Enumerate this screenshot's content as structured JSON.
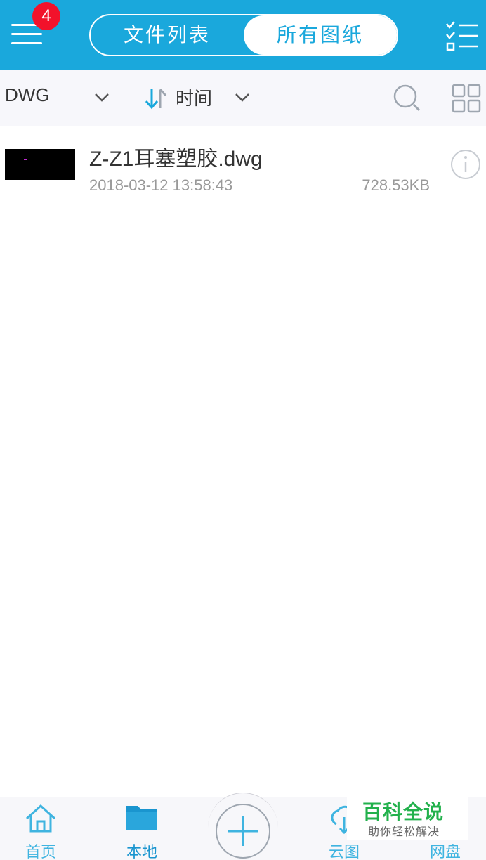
{
  "header": {
    "badge_count": "4",
    "tabs": [
      {
        "label": "文件列表",
        "selected": false
      },
      {
        "label": "所有图纸",
        "selected": true
      }
    ],
    "accent_color": "#1aa8dc"
  },
  "filter": {
    "file_type": "DWG",
    "sort_label": "时间"
  },
  "files": [
    {
      "name_prefix": "Z-Z1",
      "name_cjk": "耳塞塑胶",
      "name_ext": ".dwg",
      "date": "2018-03-12 13:58:43",
      "size": "728.53KB"
    }
  ],
  "bottom_nav": {
    "items": [
      {
        "label": "首页",
        "icon": "home-icon"
      },
      {
        "label": "本地",
        "icon": "folder-icon",
        "active": true
      },
      {
        "label": "云图",
        "icon": "cloud-icon"
      },
      {
        "label": "网盘",
        "icon": "netdisk-icon"
      }
    ],
    "fab_icon": "plus-icon"
  },
  "watermark": {
    "title": "百科全说",
    "subtitle": "助你轻松解决"
  }
}
